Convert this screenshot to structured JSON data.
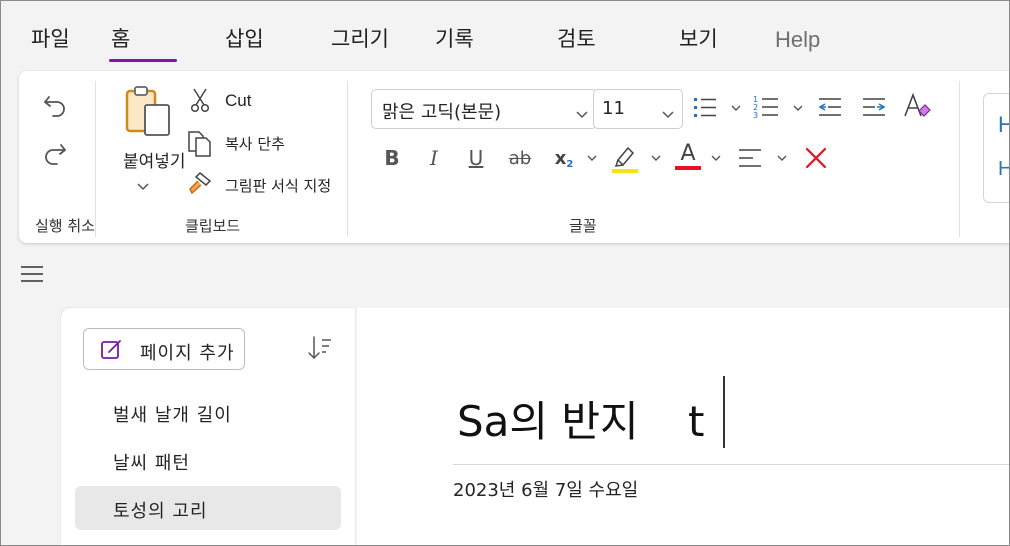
{
  "menu": {
    "tabs": [
      {
        "label": "파일"
      },
      {
        "label": "홈"
      },
      {
        "label": "삽입"
      },
      {
        "label": "그리기"
      },
      {
        "label": "기록"
      },
      {
        "label": "검토"
      },
      {
        "label": "보기"
      },
      {
        "label": "Help"
      }
    ],
    "active_tab": "홈",
    "accent_color": "#7719aa"
  },
  "ribbon": {
    "undo_group": {
      "label": "실행 취소",
      "undo_icon": "undo-icon",
      "redo_icon": "redo-icon"
    },
    "clipboard": {
      "label": "클립보드",
      "paste_label": "붙여넣기",
      "cut_label": "Cut",
      "copy_label": "복사 단추",
      "format_painter_label": "그림판 서식 지정"
    },
    "font": {
      "label": "글꼴",
      "font_name": "맑은 고딕(본문)",
      "font_size": "11",
      "bold": "B",
      "italic": "I",
      "underline": "U",
      "strikethrough": "ab",
      "subscript": "x",
      "font_color_letter": "A",
      "highlight_color": "#f5e60a",
      "font_color": "#e81123",
      "clear_icon": "clear-formatting-x-icon"
    },
    "partial_group": {
      "line1": "H",
      "line2": "H"
    }
  },
  "pages": {
    "add_page_label": "페이지 추가",
    "sort_icon": "sort-icon",
    "items": [
      {
        "label": "벌새 날개 길이"
      },
      {
        "label": "날씨 패턴"
      },
      {
        "label": "토성의 고리"
      }
    ],
    "selected_index": 2
  },
  "page": {
    "title": "Sa의 반지",
    "title_trail": "t",
    "date": "2023년 6월 7일 수요일"
  }
}
